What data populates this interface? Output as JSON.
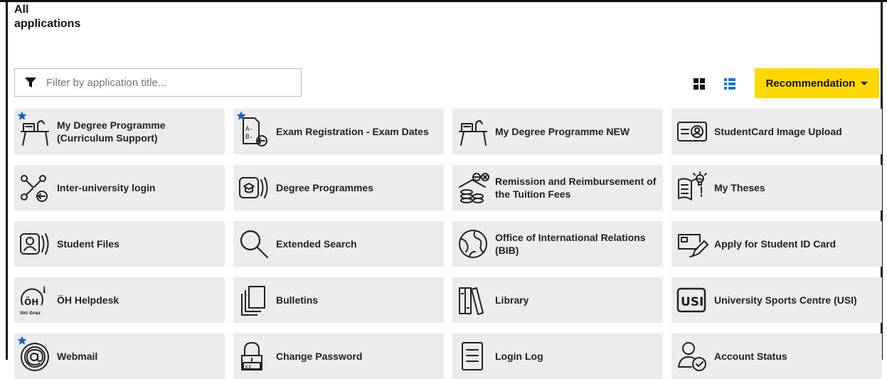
{
  "header": {
    "title_line1": "All",
    "title_line2": "applications"
  },
  "filter": {
    "placeholder": "Filter by application title..."
  },
  "toolbar": {
    "recommendation_label": "Recommendation"
  },
  "colors": {
    "accent_yellow": "#ffd800",
    "favorite_star": "#1565c0",
    "list_view_active": "#1976d2",
    "tile_bg": "#ececec"
  },
  "apps": [
    {
      "label": "My Degree Programme (Curriculum Support)",
      "icon": "degree-programme-icon",
      "favorite": true
    },
    {
      "label": "Exam Registration - Exam Dates",
      "icon": "exam-registration-icon",
      "favorite": true
    },
    {
      "label": "My Degree Programme NEW",
      "icon": "degree-programme-icon",
      "favorite": false
    },
    {
      "label": "StudentCard Image Upload",
      "icon": "student-card-icon",
      "favorite": false
    },
    {
      "label": "Inter-university login",
      "icon": "network-login-icon",
      "favorite": false
    },
    {
      "label": "Degree Programmes",
      "icon": "degree-programmes-icon",
      "favorite": false
    },
    {
      "label": "Remission and Reimbursement of the Tuition Fees",
      "icon": "tuition-coins-icon",
      "favorite": false
    },
    {
      "label": "My Theses",
      "icon": "theses-icon",
      "favorite": false
    },
    {
      "label": "Student Files",
      "icon": "student-files-icon",
      "favorite": false
    },
    {
      "label": "Extended Search",
      "icon": "search-icon",
      "favorite": false
    },
    {
      "label": "Office of International Relations (BIB)",
      "icon": "globe-icon",
      "favorite": false
    },
    {
      "label": "Apply for Student ID Card",
      "icon": "id-card-pencil-icon",
      "favorite": false
    },
    {
      "label": "ÖH Helpdesk",
      "icon": "oeh-helpdesk-logo-icon",
      "favorite": false,
      "logo_text": [
        "ÖH",
        "i",
        "Uni Graz"
      ]
    },
    {
      "label": "Bulletins",
      "icon": "bulletins-icon",
      "favorite": false
    },
    {
      "label": "Library",
      "icon": "library-books-icon",
      "favorite": false
    },
    {
      "label": "University Sports Centre (USI)",
      "icon": "usi-logo-icon",
      "favorite": false,
      "logo_text": "USI"
    },
    {
      "label": "Webmail",
      "icon": "at-sign-icon",
      "favorite": true
    },
    {
      "label": "Change Password",
      "icon": "lock-password-icon",
      "favorite": false
    },
    {
      "label": "Login Log",
      "icon": "log-document-icon",
      "favorite": false
    },
    {
      "label": "Account Status",
      "icon": "account-status-icon",
      "favorite": false
    }
  ]
}
